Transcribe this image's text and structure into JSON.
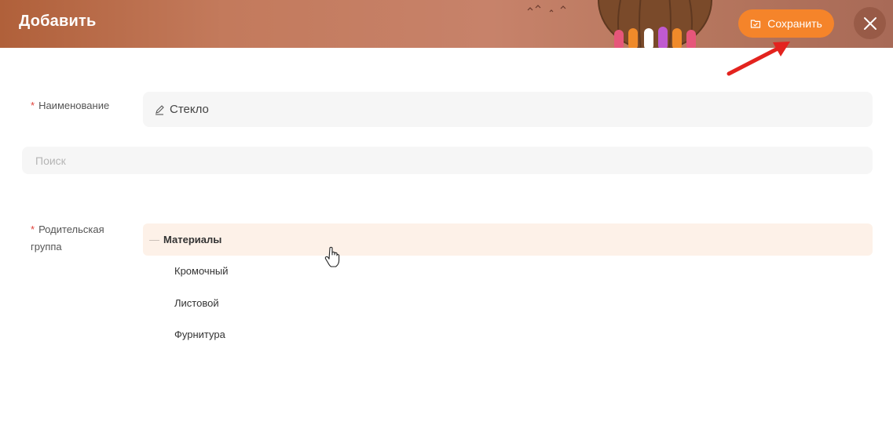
{
  "header": {
    "title": "Добавить",
    "save_label": "Сохранить",
    "save_icon": "folder-check-icon",
    "close_icon": "close-icon",
    "accent_color": "#f5842a"
  },
  "form": {
    "name_label": "Наименование",
    "name_value": "Стекло",
    "name_icon": "pencil-icon",
    "search_placeholder": "Поиск",
    "parent_label": "Родительская группа",
    "required_mark": "*"
  },
  "tree": {
    "root": {
      "toggle": "—",
      "label": "Материалы"
    },
    "children": [
      "Кромочный",
      "Листовой",
      "Фурнитура"
    ]
  }
}
